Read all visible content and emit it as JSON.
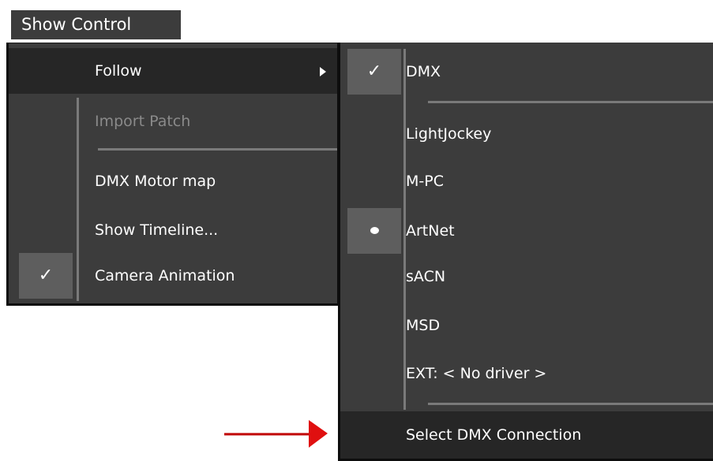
{
  "menubar": {
    "title": "Show Control"
  },
  "main_menu": {
    "items": [
      {
        "label": "Follow",
        "has_submenu": true,
        "highlighted": true
      },
      {
        "label": "Import Patch",
        "disabled": true
      },
      {
        "label": "DMX Motor map"
      },
      {
        "label": "Show Timeline..."
      },
      {
        "label": "Camera Animation",
        "checked": true
      }
    ]
  },
  "sub_menu": {
    "items": [
      {
        "label": "DMX",
        "checked": true
      },
      {
        "label": "LightJockey"
      },
      {
        "label": "M-PC"
      },
      {
        "label": "ArtNet",
        "selected_radio": true
      },
      {
        "label": "sACN"
      },
      {
        "label": "MSD"
      },
      {
        "label": "EXT: < No driver >"
      },
      {
        "label": "Select DMX Connection",
        "highlighted": true
      }
    ]
  },
  "icons": {
    "check": "check-icon",
    "radio": "bullet-icon",
    "submenu": "submenu-arrow-icon",
    "annotation": "red-arrow-icon"
  },
  "colors": {
    "menu_bg": "#3c3c3c",
    "highlight_bg": "#262626",
    "check_bg": "#5e5e5e",
    "disabled_text": "#8a8a8a",
    "annotation_arrow": "#e01010"
  }
}
